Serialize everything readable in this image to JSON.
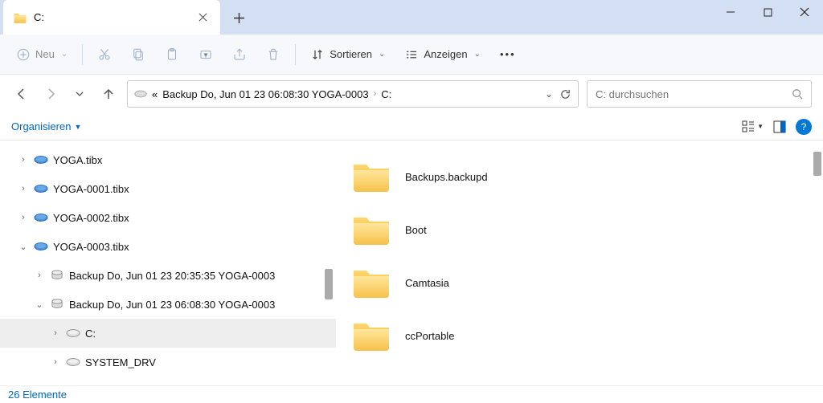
{
  "window": {
    "tab_title": "C:"
  },
  "toolbar": {
    "new_label": "Neu",
    "sort_label": "Sortieren",
    "view_label": "Anzeigen"
  },
  "nav": {
    "crumb_prefix": "«",
    "crumb1": "Backup Do, Jun 01 23 06:08:30 YOGA-0003",
    "crumb2": "C:",
    "search_placeholder": "C: durchsuchen"
  },
  "orgbar": {
    "label": "Organisieren"
  },
  "tree": [
    {
      "indent": 0,
      "exp": "›",
      "icon": "disk",
      "label": "YOGA.tibx"
    },
    {
      "indent": 0,
      "exp": "›",
      "icon": "disk",
      "label": "YOGA-0001.tibx"
    },
    {
      "indent": 0,
      "exp": "›",
      "icon": "disk",
      "label": "YOGA-0002.tibx"
    },
    {
      "indent": 0,
      "exp": "⌄",
      "icon": "disk",
      "label": "YOGA-0003.tibx"
    },
    {
      "indent": 1,
      "exp": "›",
      "icon": "dbdrive",
      "label": "Backup Do, Jun 01 23 20:35:35 YOGA-0003"
    },
    {
      "indent": 1,
      "exp": "⌄",
      "icon": "dbdrive",
      "label": "Backup Do, Jun 01 23 06:08:30 YOGA-0003"
    },
    {
      "indent": 2,
      "exp": "›",
      "icon": "drive",
      "label": "C:",
      "selected": true
    },
    {
      "indent": 2,
      "exp": "›",
      "icon": "drive",
      "label": "SYSTEM_DRV"
    }
  ],
  "files": [
    {
      "name": "Backups.backupd"
    },
    {
      "name": "Boot"
    },
    {
      "name": "Camtasia"
    },
    {
      "name": "ccPortable"
    }
  ],
  "status": {
    "text": "26 Elemente"
  }
}
